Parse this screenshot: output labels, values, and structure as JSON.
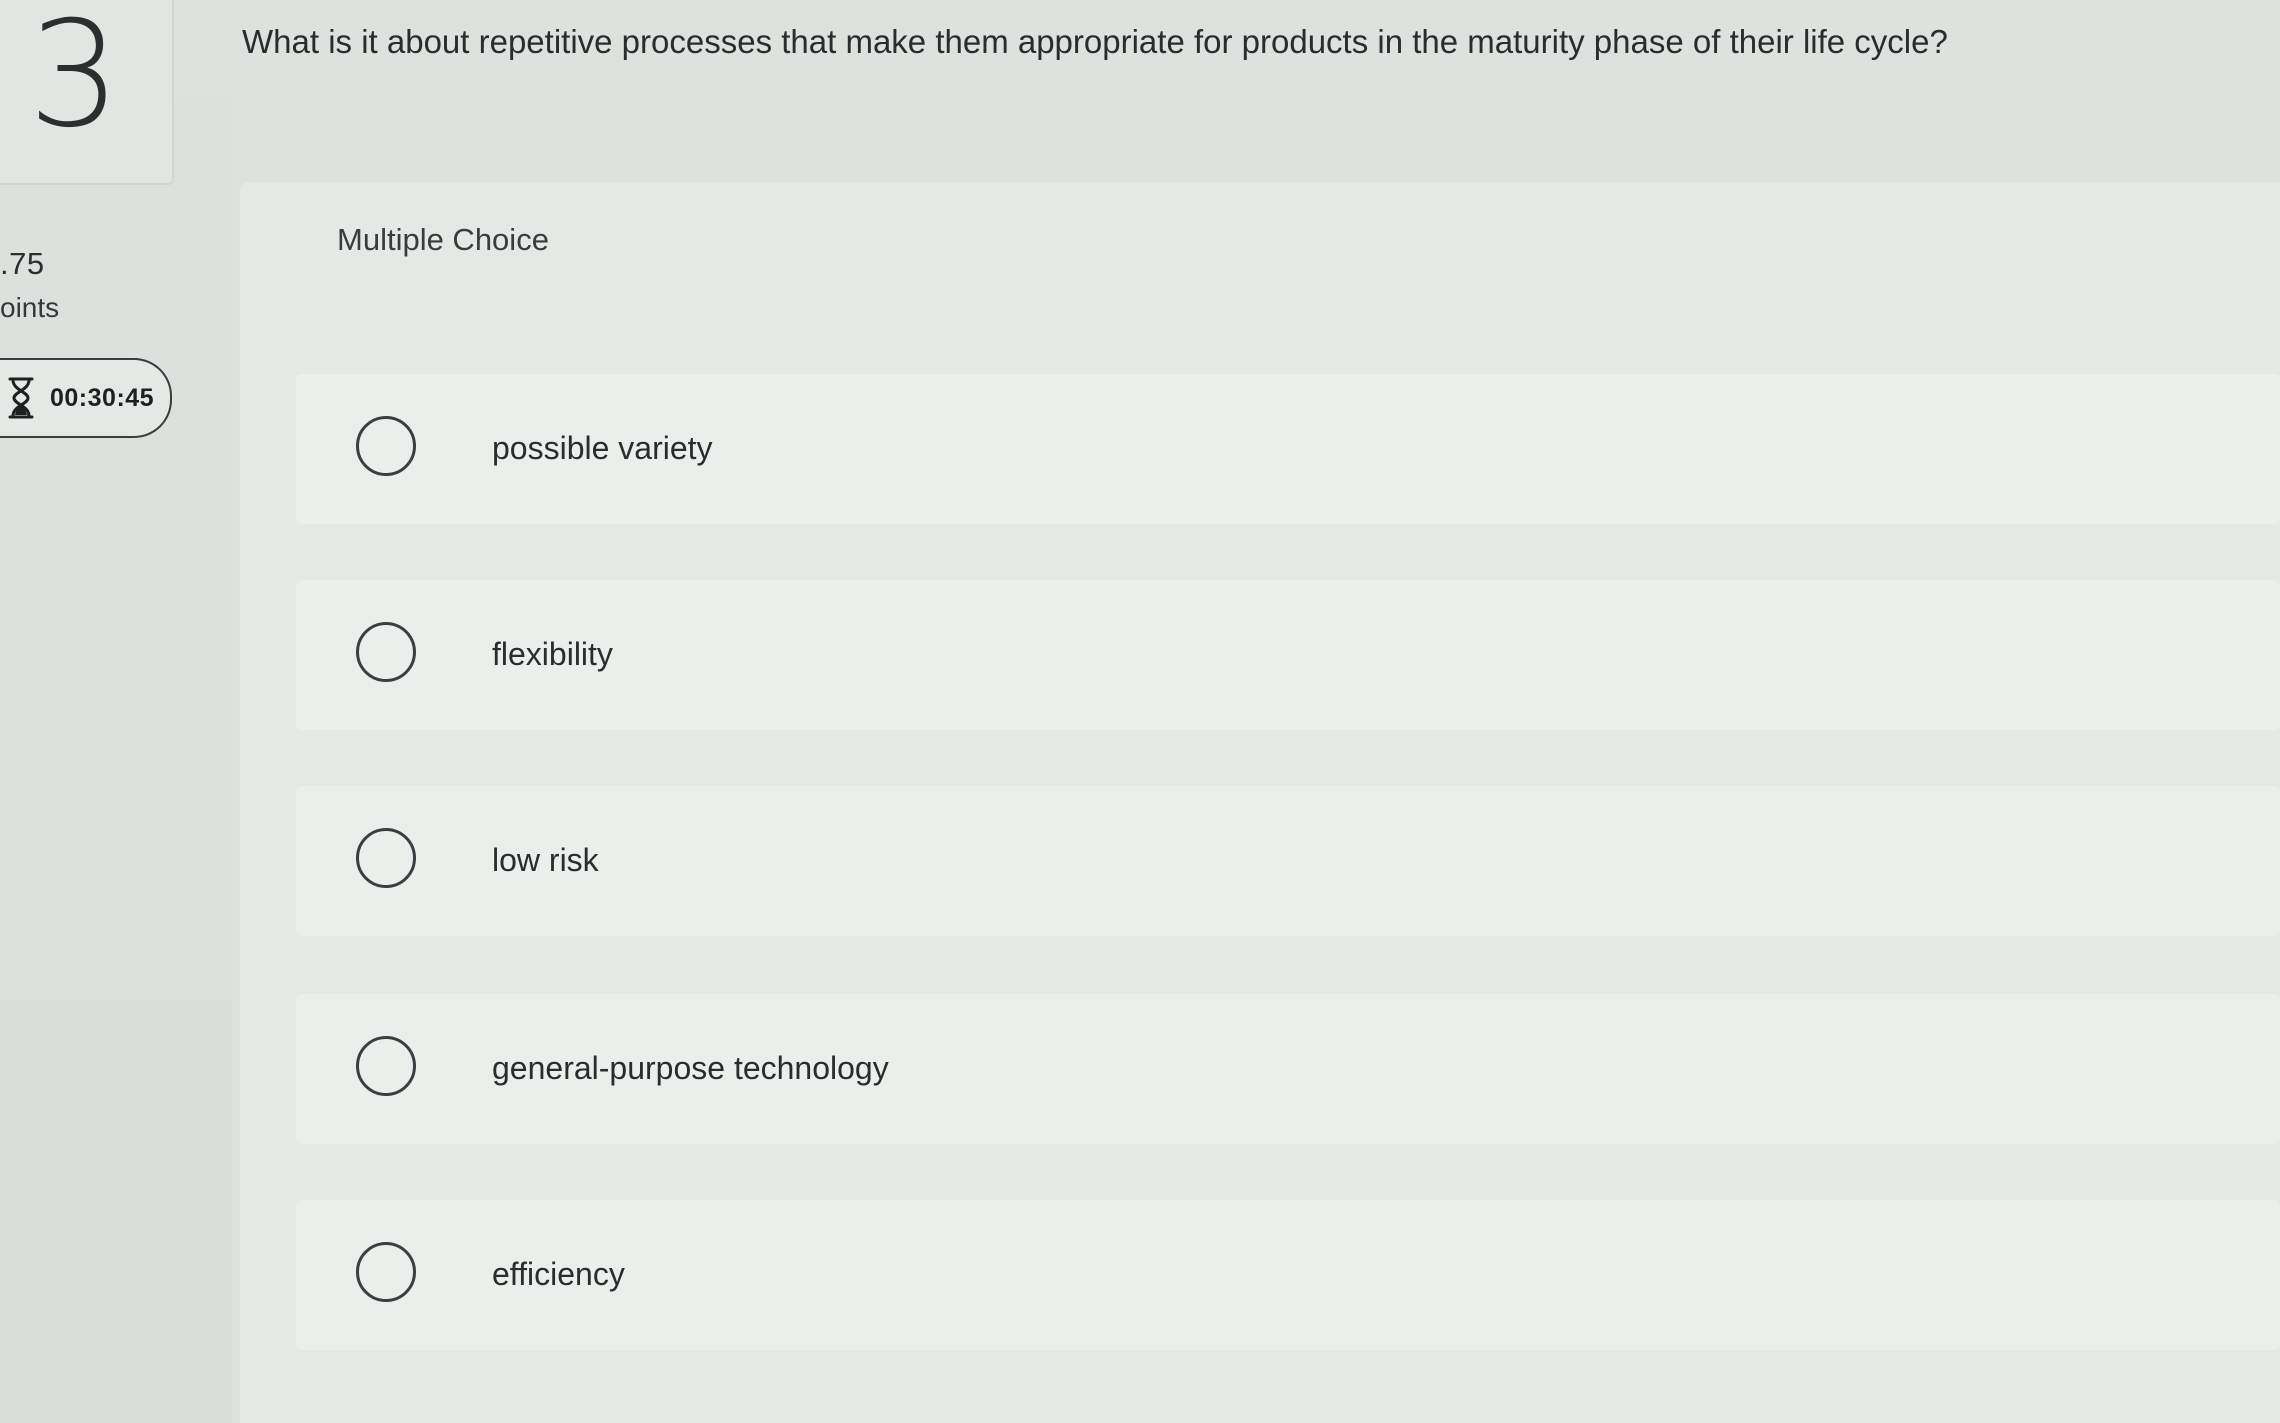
{
  "question": {
    "number": "3",
    "text": "What is it about repetitive processes that make them appropriate for products in the maturity phase of their life cycle?",
    "points_value": ".75",
    "points_label": "oints"
  },
  "timer": {
    "icon": "hourglass-icon",
    "time": "00:30:45"
  },
  "answer_area": {
    "type_label": "Multiple Choice",
    "options": [
      {
        "label": "possible variety"
      },
      {
        "label": "flexibility"
      },
      {
        "label": "low risk"
      },
      {
        "label": "general-purpose technology"
      },
      {
        "label": "efficiency"
      }
    ]
  }
}
